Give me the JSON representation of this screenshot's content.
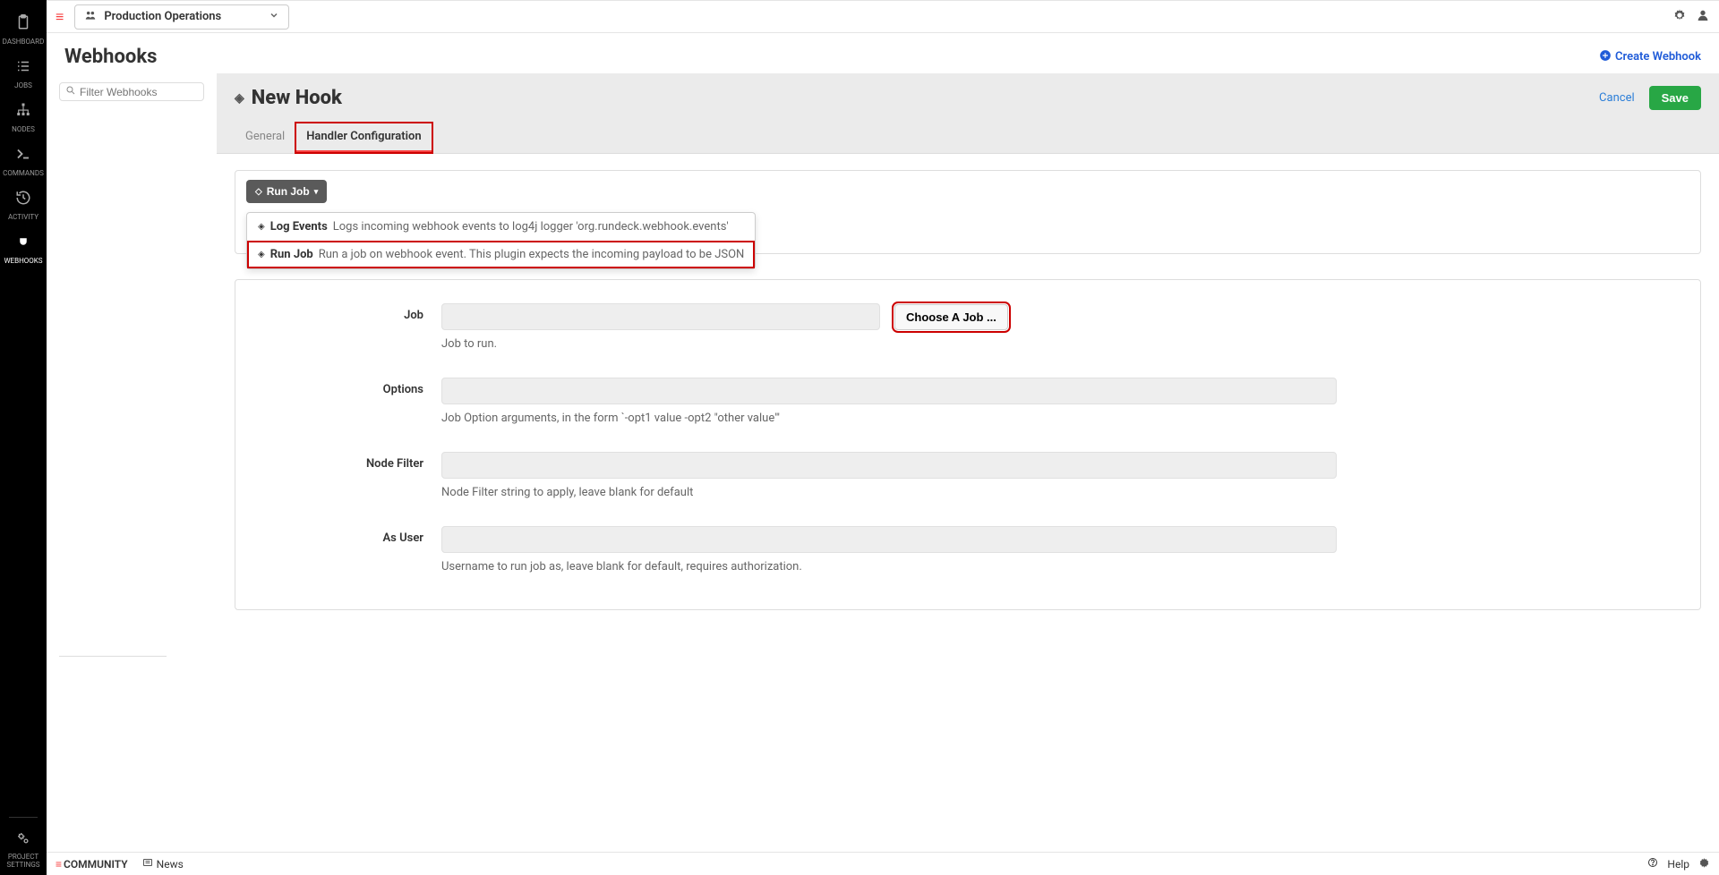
{
  "topbar": {
    "project_name": "Production Operations"
  },
  "sidebar": {
    "items": [
      {
        "label": "DASHBOARD"
      },
      {
        "label": "JOBS"
      },
      {
        "label": "NODES"
      },
      {
        "label": "COMMANDS"
      },
      {
        "label": "ACTIVITY"
      },
      {
        "label": "WEBHOOKS"
      }
    ],
    "settings_label": "PROJECT\nSETTINGS"
  },
  "page": {
    "title": "Webhooks",
    "create_label": "Create Webhook",
    "filter_placeholder": "Filter Webhooks"
  },
  "detail": {
    "title": "New Hook",
    "cancel_label": "Cancel",
    "save_label": "Save",
    "tabs": {
      "general": "General",
      "handler": "Handler Configuration"
    }
  },
  "handler": {
    "button_label": "Run Job",
    "dropdown": {
      "log_events": {
        "label": "Log Events",
        "desc": "Logs incoming webhook events to log4j logger 'org.rundeck.webhook.events'"
      },
      "run_job": {
        "label": "Run Job",
        "desc": "Run a job on webhook event. This plugin expects the incoming payload to be JSON"
      }
    }
  },
  "fields": {
    "job": {
      "label": "Job",
      "help": "Job to run.",
      "choose_label": "Choose A Job ..."
    },
    "options": {
      "label": "Options",
      "help": "Job Option arguments, in the form `-opt1 value -opt2 \"other value\"'"
    },
    "node_filter": {
      "label": "Node Filter",
      "help": "Node Filter string to apply, leave blank for default"
    },
    "as_user": {
      "label": "As User",
      "help": "Username to run job as, leave blank for default, requires authorization."
    }
  },
  "footer": {
    "community": "COMMUNITY",
    "news": "News",
    "help": "Help"
  }
}
